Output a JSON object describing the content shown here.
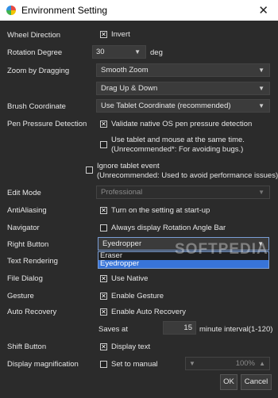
{
  "window": {
    "title": "Environment Setting",
    "close_glyph": "✕"
  },
  "rows": {
    "wheel_direction": {
      "label": "Wheel Direction",
      "checkbox": "Invert",
      "checked": true
    },
    "rotation_degree": {
      "label": "Rotation Degree",
      "value": "30",
      "unit": "deg"
    },
    "zoom_by_dragging": {
      "label": "Zoom by Dragging",
      "combo1": "Smooth Zoom",
      "combo2": "Drag Up & Down"
    },
    "brush_coordinate": {
      "label": "Brush Coordinate",
      "combo": "Use Tablet Coordinate (recommended)"
    },
    "pen_pressure": {
      "label": "Pen Pressure Detection",
      "cb1": "Validate native OS pen pressure detection",
      "cb1_checked": true,
      "cb2_line1": "Use tablet and mouse at the same time.",
      "cb2_line2": "(Unrecommended*: For avoiding bugs.)",
      "cb2_checked": false,
      "cb3_line1": "Ignore tablet event",
      "cb3_line2": "(Unrecommended: Used to avoid performance issues)",
      "cb3_checked": false
    },
    "edit_mode": {
      "label": "Edit Mode",
      "combo": "Professional"
    },
    "antialiasing": {
      "label": "AntiAliasing",
      "checkbox": "Turn on the setting at start-up",
      "checked": true
    },
    "navigator": {
      "label": "Navigator",
      "checkbox": "Always display Rotation Angle Bar",
      "checked": false
    },
    "right_button": {
      "label": "Right Button",
      "combo": "Eyedropper",
      "options": [
        "Eraser",
        "Eyedropper"
      ],
      "selected": "Eyedropper"
    },
    "text_rendering": {
      "label": "Text Rendering"
    },
    "file_dialog": {
      "label": "File Dialog",
      "checkbox": "Use Native",
      "checked": true
    },
    "gesture": {
      "label": "Gesture",
      "checkbox": "Enable Gesture",
      "checked": true
    },
    "auto_recovery": {
      "label": "Auto Recovery",
      "checkbox": "Enable Auto Recovery",
      "checked": true,
      "saves_at_label": "Saves at",
      "saves_at_value": "15",
      "interval_text": "minute interval(1-120)"
    },
    "shift_button": {
      "label": "Shift Button",
      "checkbox": "Display text",
      "checked": true
    },
    "display_magnification": {
      "label": "Display magnification",
      "checkbox": "Set to manual",
      "checked": false,
      "value": "100%"
    }
  },
  "buttons": {
    "ok": "OK",
    "cancel": "Cancel"
  },
  "watermark": "SOFTPEDIA"
}
